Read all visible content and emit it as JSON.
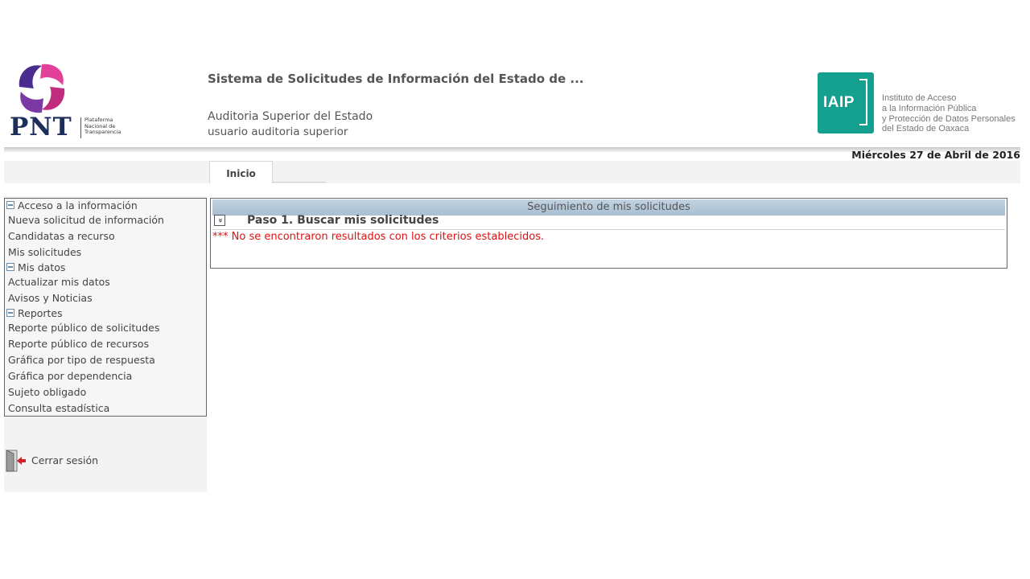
{
  "header": {
    "pnt_logo": {
      "wordmark": "PNT",
      "tagline": "Plataforma\nNacional de\nTransparencia"
    },
    "app_title": "Sistema de Solicitudes de Información del Estado de ...",
    "organization": "Auditoria Superior del Estado",
    "user": "usuario auditoria superior",
    "iaip_logo": {
      "wordmark": "IAIP",
      "description": "Instituto de Acceso\na la Información Pública\ny Protección de Datos Personales\ndel Estado de Oaxaca",
      "color": "#14a08f"
    },
    "date": "Miércoles 27 de Abril de 2016"
  },
  "tabs": [
    {
      "label": "Inicio",
      "active": true
    }
  ],
  "sidebar": {
    "items": [
      {
        "label": "Acceso a la información",
        "type": "section",
        "icon": "collapse-box-icon"
      },
      {
        "label": "Nueva solicitud de información",
        "type": "link"
      },
      {
        "label": "Candidatas a recurso",
        "type": "link"
      },
      {
        "label": "Mis solicitudes",
        "type": "link"
      },
      {
        "label": "Mis datos",
        "type": "section",
        "icon": "collapse-box-icon"
      },
      {
        "label": "Actualizar mis datos",
        "type": "link"
      },
      {
        "label": "Avisos y Noticias",
        "type": "link"
      },
      {
        "label": "Reportes",
        "type": "section",
        "icon": "collapse-box-icon"
      },
      {
        "label": "Reporte público de solicitudes",
        "type": "link"
      },
      {
        "label": "Reporte público de recursos",
        "type": "link"
      },
      {
        "label": "Gráfica por tipo de respuesta",
        "type": "link"
      },
      {
        "label": "Gráfica por dependencia",
        "type": "link"
      },
      {
        "label": "Sujeto obligado",
        "type": "link"
      },
      {
        "label": "Consulta estadística",
        "type": "link"
      }
    ],
    "logout_label": "Cerrar sesión",
    "logout_icon": "exit-door-icon"
  },
  "main": {
    "panel_title": "Seguimiento de mis solicitudes",
    "step_title": "Paso 1. Buscar mis solicitudes",
    "message": "*** No se encontraron resultados con los criterios establecidos.",
    "message_color": "#e01010"
  }
}
